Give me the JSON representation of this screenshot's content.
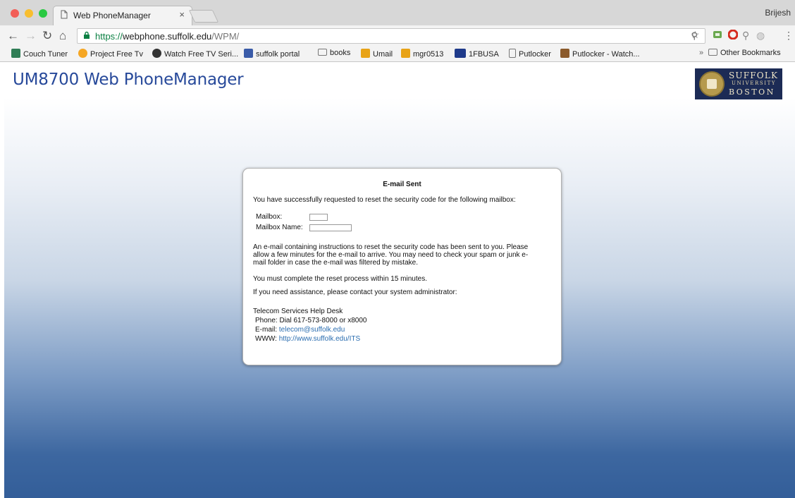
{
  "browser": {
    "tab_title": "Web PhoneManager",
    "tab_close": "×",
    "profile_name": "Brijesh",
    "url_scheme": "https://",
    "url_host": "webphone.suffolk.edu",
    "url_path": "/WPM/",
    "bookmarks": [
      {
        "label": "Couch Tuner",
        "icon": "tv-icon",
        "color": "#2f7d55"
      },
      {
        "label": "Project Free Tv",
        "icon": "star-icon",
        "color": "#f5a623"
      },
      {
        "label": "Watch Free TV Seri...",
        "icon": "play-icon",
        "color": "#333333"
      },
      {
        "label": "suffolk portal",
        "icon": "portal-icon",
        "color": "#3a5ba8"
      },
      {
        "label": "books",
        "icon": "folder-icon",
        "color": "#7a7a7a"
      },
      {
        "label": "Umail",
        "icon": "outlook-icon",
        "color": "#e8a317"
      },
      {
        "label": "mgr0513",
        "icon": "outlook-icon",
        "color": "#e8a317"
      },
      {
        "label": "1FBUSA",
        "icon": "fbusa-icon",
        "color": "#1e3a8a"
      },
      {
        "label": "Putlocker",
        "icon": "page-icon",
        "color": "#7a7a7a"
      },
      {
        "label": "Putlocker - Watch...",
        "icon": "film-icon",
        "color": "#8b5a2b"
      }
    ],
    "overflow": "»",
    "other_bookmarks": "Other Bookmarks"
  },
  "page": {
    "app_title": "UM8700 Web PhoneManager",
    "logo": {
      "line1": "SUFFOLK",
      "line2": "UNIVERSITY",
      "line3": "BOSTON"
    }
  },
  "dialog": {
    "title": "E-mail Sent",
    "intro": "You have successfully requested to reset the security code for the following mailbox:",
    "mailbox_label": "Mailbox:",
    "mailbox_name_label": "Mailbox Name:",
    "mailbox_value": "",
    "mailbox_name_value": "",
    "instructions_1": "An e-mail containing instructions to reset the security code has been sent to you. Please",
    "instructions_2": "allow a few minutes for the e-mail to arrive. You may need to check your spam or junk e-",
    "instructions_3": "mail folder in case the e-mail was filtered by mistake.",
    "deadline": "You must complete the reset process within 15 minutes.",
    "assistance": "If you need assistance, please contact your system administrator:",
    "contact": {
      "org": "Telecom Services Help Desk",
      "phone_label": "Phone:",
      "phone_value": "Dial 617-573-8000 or x8000",
      "email_label": "E-mail:",
      "email_value": "telecom@suffolk.edu",
      "www_label": "WWW:",
      "www_value": "http://www.suffolk.edu/ITS"
    }
  }
}
